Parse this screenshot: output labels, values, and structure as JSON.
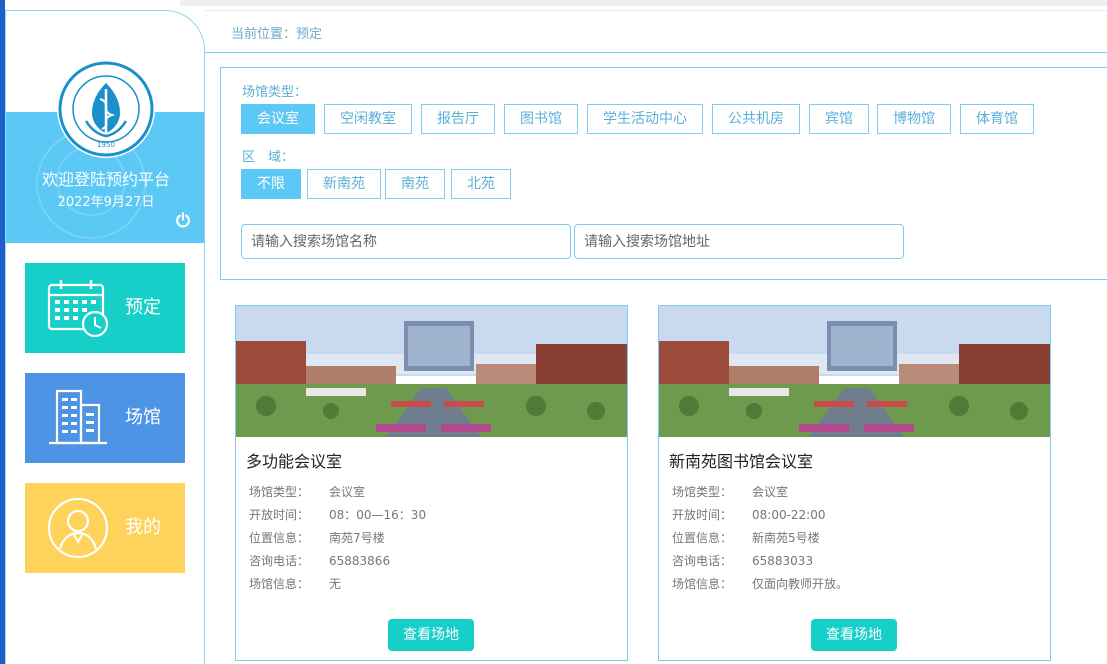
{
  "sidebar": {
    "logo_text": "上海健康医学院",
    "logo_sub": "SHANGHAI UNIVERSITY OF MEDICINE & HEALTH SCIENCES",
    "logo_year": "1950",
    "welcome": "欢迎登陆预约平台",
    "date": "2022年9月27日",
    "nav": [
      {
        "label": "预定",
        "icon": "calendar-clock-icon",
        "color": "#16cfc8"
      },
      {
        "label": "场馆",
        "icon": "building-icon",
        "color": "#4e94e4"
      },
      {
        "label": "我的",
        "icon": "user-avatar-icon",
        "color": "#fdd35c"
      }
    ]
  },
  "breadcrumb": "当前位置：预定",
  "filters": {
    "type_label": "场馆类型：",
    "types": [
      "会议室",
      "空闲教室",
      "报告厅",
      "图书馆",
      "学生活动中心",
      "公共机房",
      "宾馆",
      "博物馆",
      "体育馆"
    ],
    "type_selected": "会议室",
    "area_label": "区　域：",
    "areas": [
      "不限",
      "新南苑",
      "南苑",
      "北苑"
    ],
    "area_selected": "不限",
    "search_name_placeholder": "请输入搜索场馆名称",
    "search_address_placeholder": "请输入搜索场馆地址"
  },
  "cards": [
    {
      "title": "多功能会议室",
      "rows": [
        {
          "k": "场馆类型：",
          "v": "会议室"
        },
        {
          "k": "开放时间：",
          "v": "08：00—16：30"
        },
        {
          "k": "位置信息：",
          "v": "南苑7号楼"
        },
        {
          "k": "咨询电话：",
          "v": "65883866"
        },
        {
          "k": "场馆信息：",
          "v": "无"
        }
      ],
      "button": "查看场地"
    },
    {
      "title": "新南苑图书馆会议室",
      "rows": [
        {
          "k": "场馆类型：",
          "v": "会议室"
        },
        {
          "k": "开放时间：",
          "v": "08:00-22:00"
        },
        {
          "k": "位置信息：",
          "v": "新南苑5号楼"
        },
        {
          "k": "咨询电话：",
          "v": "65883033"
        },
        {
          "k": "场馆信息：",
          "v": "仅面向教师开放。"
        }
      ],
      "button": "查看场地"
    }
  ],
  "colors": {
    "accent": "#5bc8f5",
    "teal": "#16cfc8",
    "border": "#7dcdf0"
  }
}
